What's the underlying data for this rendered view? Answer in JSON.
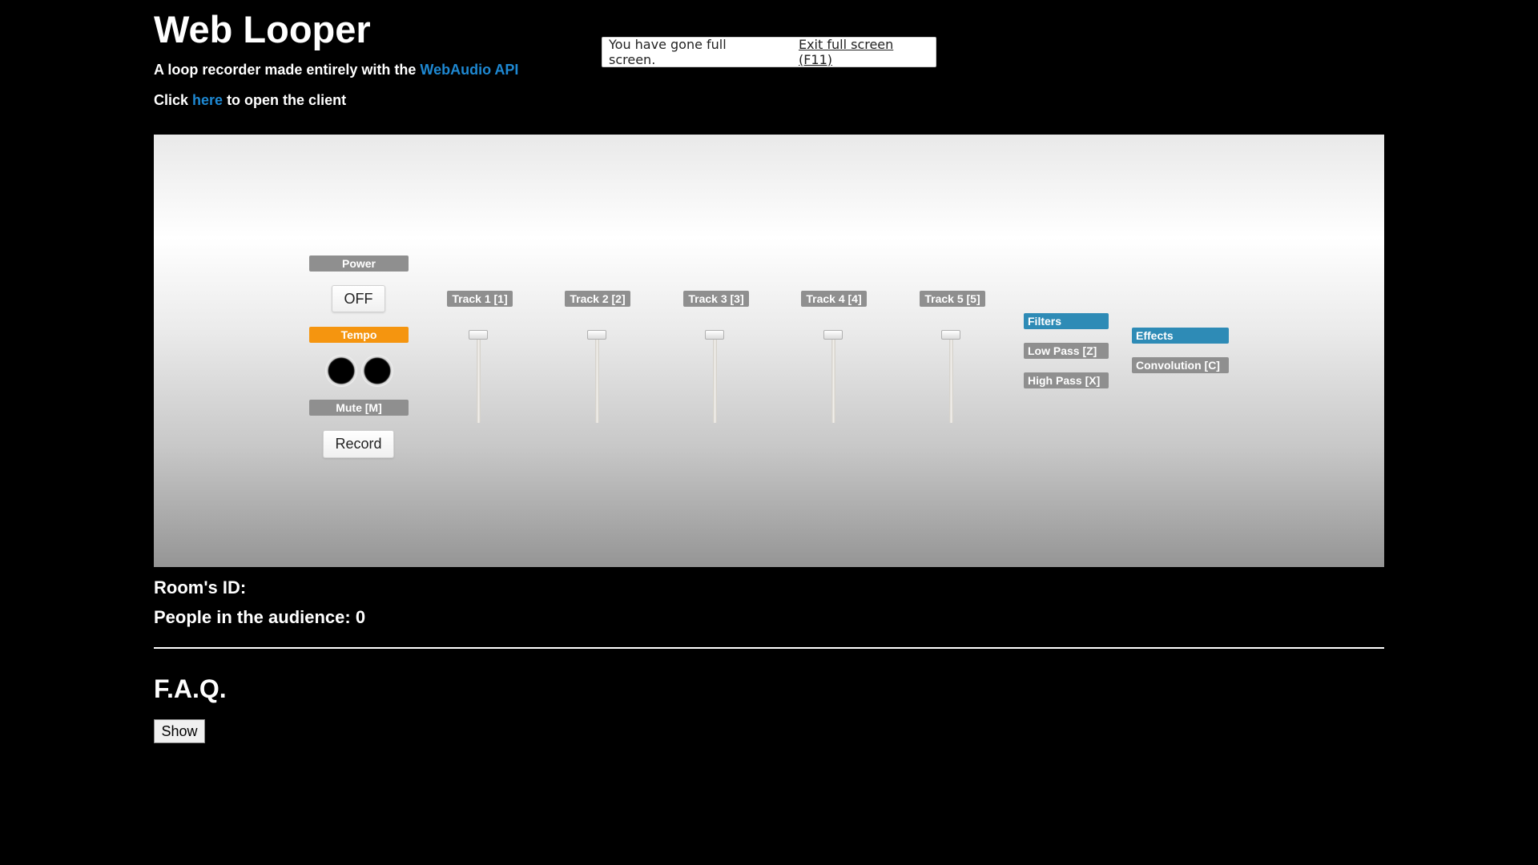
{
  "header": {
    "title": "Web Looper",
    "subtitle_prefix": "A loop recorder made entirely with the ",
    "subtitle_link": "WebAudio API",
    "client_prefix": "Click ",
    "client_link": "here",
    "client_suffix": " to open the client"
  },
  "fullscreen_notice": {
    "message": "You have gone full screen.",
    "exit_label": "Exit full screen (F11)"
  },
  "looper": {
    "power_label": "Power",
    "power_button": "OFF",
    "tempo_label": "Tempo",
    "mute_label": "Mute [M]",
    "record_button": "Record",
    "tracks": [
      {
        "label": "Track 1 [1]",
        "level": 1.0
      },
      {
        "label": "Track 2 [2]",
        "level": 1.0
      },
      {
        "label": "Track 3 [3]",
        "level": 1.0
      },
      {
        "label": "Track 4 [4]",
        "level": 1.0
      },
      {
        "label": "Track 5 [5]",
        "level": 1.0
      }
    ],
    "filters": {
      "heading": "Filters",
      "items": [
        "Low Pass [Z]",
        "High Pass [X]"
      ]
    },
    "effects": {
      "heading": "Effects",
      "items": [
        "Convolution [C]"
      ]
    }
  },
  "room": {
    "id_label": "Room's ID:",
    "audience_label": "People in the audience: 0"
  },
  "faq": {
    "title": "F.A.Q.",
    "show_button": "Show"
  },
  "colors": {
    "link": "#1e88d2",
    "tempo": "#f5950f",
    "section_heading": "#2e8bb6",
    "label_gray": "#8f8f8f"
  }
}
